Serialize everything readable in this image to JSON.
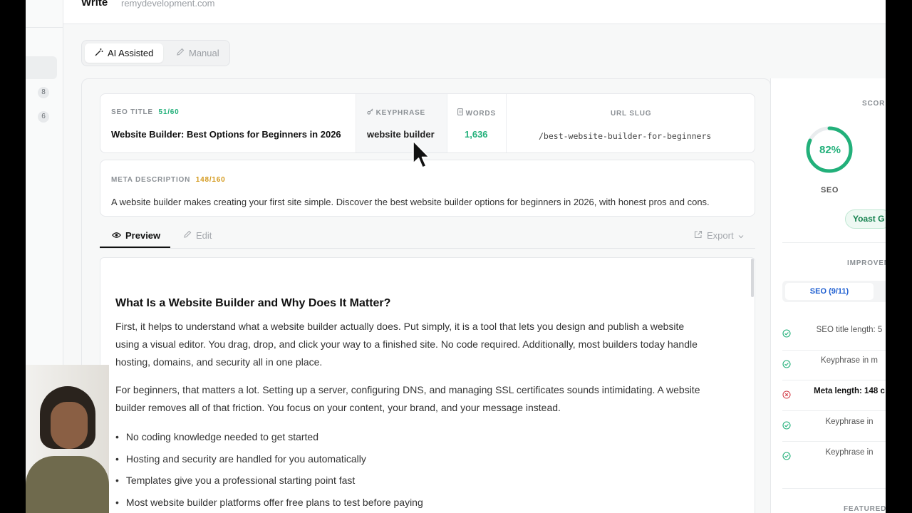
{
  "header": {
    "title": "Write",
    "domain": "remydevelopment.com"
  },
  "rail": {
    "badges": [
      "8",
      "6"
    ]
  },
  "modes": {
    "ai": "AI Assisted",
    "manual": "Manual"
  },
  "seo": {
    "title_label": "SEO TITLE",
    "title_count": "51/60",
    "title_value": "Website Builder: Best Options for Beginners in 2026",
    "keyphrase_label": "KEYPHRASE",
    "keyphrase_value": "website builder",
    "words_label": "WORDS",
    "words_value": "1,636",
    "slug_label": "URL SLUG",
    "slug_value": "/best-website-builder-for-beginners"
  },
  "meta": {
    "label": "META DESCRIPTION",
    "count": "148/160",
    "value": "A website builder makes creating your first site simple. Discover the best website builder options for beginners in 2026, with honest pros and cons."
  },
  "tabs": {
    "preview": "Preview",
    "edit": "Edit",
    "export": "Export"
  },
  "article": {
    "heading": "What Is a Website Builder and Why Does It Matter?",
    "para1": [
      "First, it helps to understand what a website builder actually does. Put simply, it is a tool that lets you design and publish a website",
      "using a visual editor. You drag, drop, and click your way to a finished site. No code required. Additionally, most builders today handle",
      "hosting, domains, and security all in one place."
    ],
    "para2": [
      "For beginners, that matters a lot. Setting up a server, configuring DNS, and managing SSL certificates sounds intimidating. A website",
      "builder removes all of that friction. You focus on your content, your brand, and your message instead."
    ],
    "bullets": [
      "No coding knowledge needed to get started",
      "Hosting and security are handled for you automatically",
      "Templates give you a professional starting point fast",
      "Most website builder platforms offer free plans to test before paying"
    ]
  },
  "sidebar": {
    "score_label": "SCOR",
    "score": "82%",
    "score_fraction": 0.82,
    "score_caption": "SEO",
    "yoast": "Yoast G",
    "improve_label": "IMPROVEN",
    "seo_tab": "SEO (9/11)",
    "checks": [
      {
        "text": "SEO title length: 5",
        "status": "pass"
      },
      {
        "text": "Keyphrase in m",
        "status": "pass"
      },
      {
        "text": "Meta length: 148 c",
        "status": "fail"
      },
      {
        "text": "Keyphrase in",
        "status": "pass"
      },
      {
        "text": "Keyphrase in",
        "status": "pass"
      }
    ],
    "featured_label": "FEATURED"
  },
  "colors": {
    "accent_green": "#22b07a",
    "amber": "#d49a1e",
    "fail_red": "#d64550",
    "link_blue": "#1f5fd1"
  }
}
